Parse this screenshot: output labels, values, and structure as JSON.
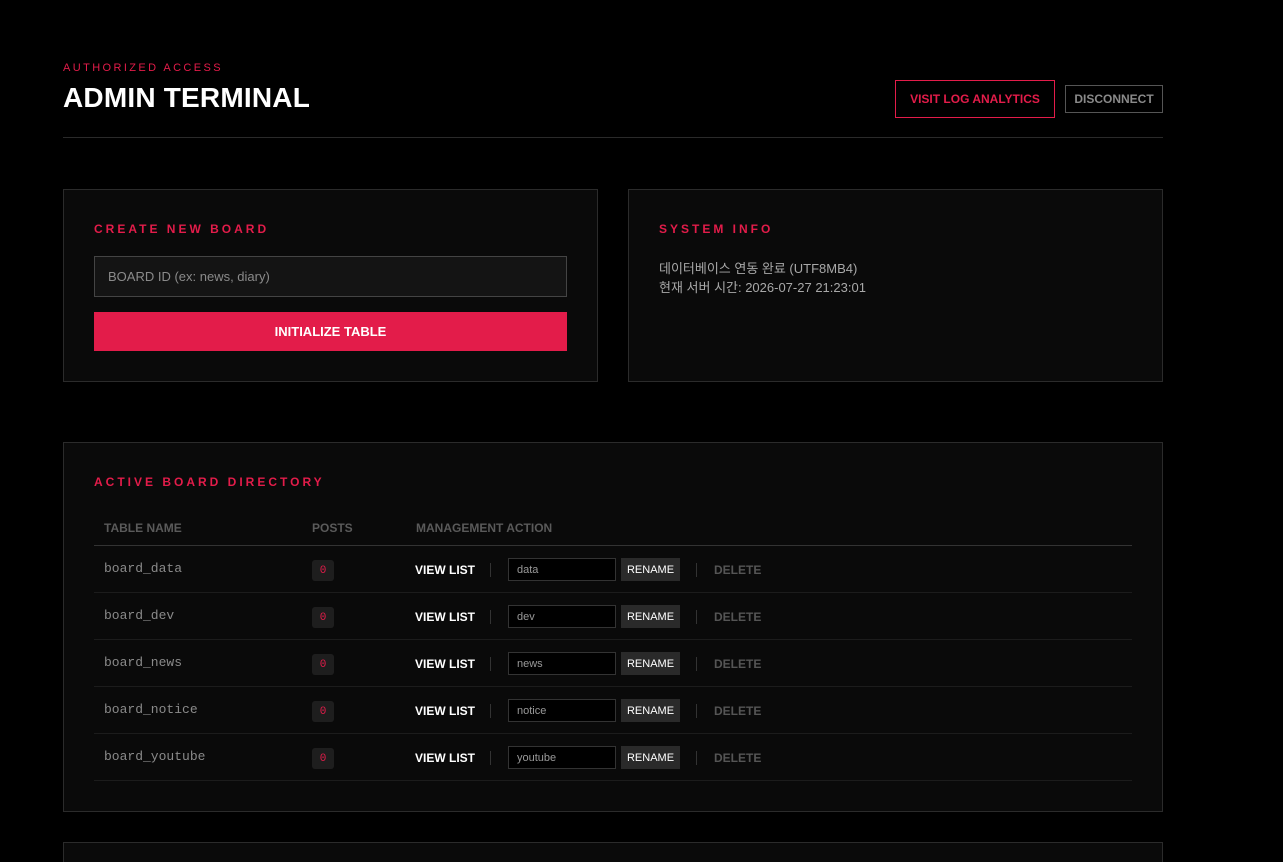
{
  "header": {
    "eyebrow": "AUTHORIZED ACCESS",
    "title": "ADMIN TERMINAL",
    "visit_log_label": "VISIT LOG ANALYTICS",
    "disconnect_label": "DISCONNECT"
  },
  "create_board": {
    "title": "CREATE NEW BOARD",
    "input_value": "",
    "input_placeholder": "BOARD ID (ex: news, diary)",
    "button_label": "INITIALIZE TABLE"
  },
  "system_info": {
    "title": "SYSTEM INFO",
    "line1": "데이터베이스 연동 완료 (UTF8MB4)",
    "line2": "현재 서버 시간: 2026-07-27 21:23:01"
  },
  "directory": {
    "title": "ACTIVE BOARD DIRECTORY",
    "columns": [
      "TABLE NAME",
      "POSTS",
      "MANAGEMENT ACTION"
    ],
    "view_label": "VIEW LIST",
    "rename_label": "RENAME",
    "delete_label": "DELETE",
    "rows": [
      {
        "table": "board_data",
        "posts": "0",
        "rename_value": "data"
      },
      {
        "table": "board_dev",
        "posts": "0",
        "rename_value": "dev"
      },
      {
        "table": "board_news",
        "posts": "0",
        "rename_value": "news"
      },
      {
        "table": "board_notice",
        "posts": "0",
        "rename_value": "notice"
      },
      {
        "table": "board_youtube",
        "posts": "0",
        "rename_value": "youtube"
      }
    ]
  },
  "colors": {
    "accent": "#e31c4a",
    "background": "#000000",
    "panel": "#0a0a0a"
  }
}
